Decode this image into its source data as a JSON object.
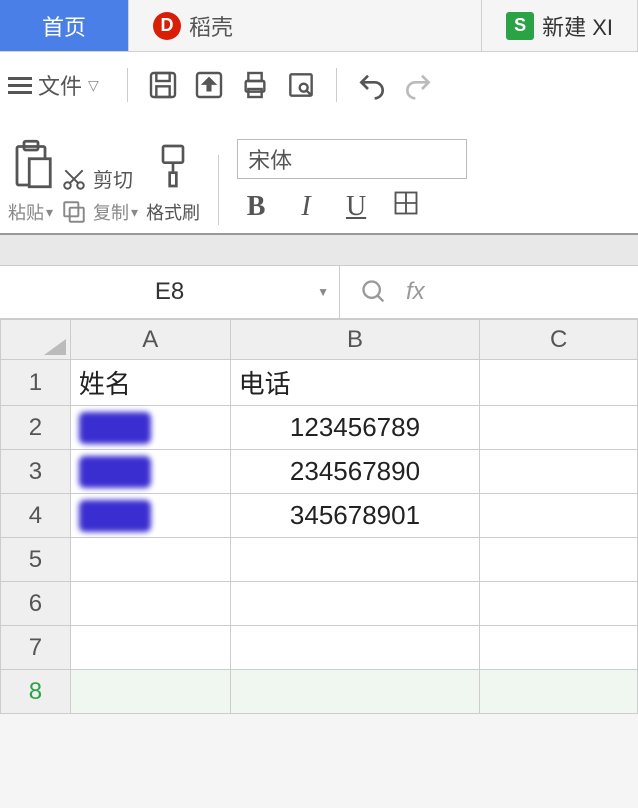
{
  "tabs": {
    "home": "首页",
    "docer": "稻壳",
    "new": "新建 XI"
  },
  "toolbar": {
    "file": "文件",
    "paste": "粘贴",
    "cut": "剪切",
    "copy": "复制",
    "format_brush": "格式刷",
    "font_name": "宋体",
    "bold": "B",
    "italic": "I",
    "underline": "U"
  },
  "formula": {
    "cell_ref": "E8",
    "fx": "fx"
  },
  "grid": {
    "columns": [
      "A",
      "B",
      "C"
    ],
    "row_headers": [
      "1",
      "2",
      "3",
      "4",
      "5",
      "6",
      "7",
      "8"
    ],
    "active_row": 8,
    "headers": {
      "A": "姓名",
      "B": "电话"
    },
    "rows": [
      {
        "A_hidden": true,
        "B": "123456789"
      },
      {
        "A_hidden": true,
        "B": "234567890"
      },
      {
        "A_hidden": true,
        "B": "345678901"
      }
    ]
  },
  "chart_data": {
    "type": "table",
    "columns": [
      "姓名",
      "电话"
    ],
    "rows": [
      [
        "(redacted)",
        "123456789"
      ],
      [
        "(redacted)",
        "234567890"
      ],
      [
        "(redacted)",
        "345678901"
      ]
    ]
  }
}
